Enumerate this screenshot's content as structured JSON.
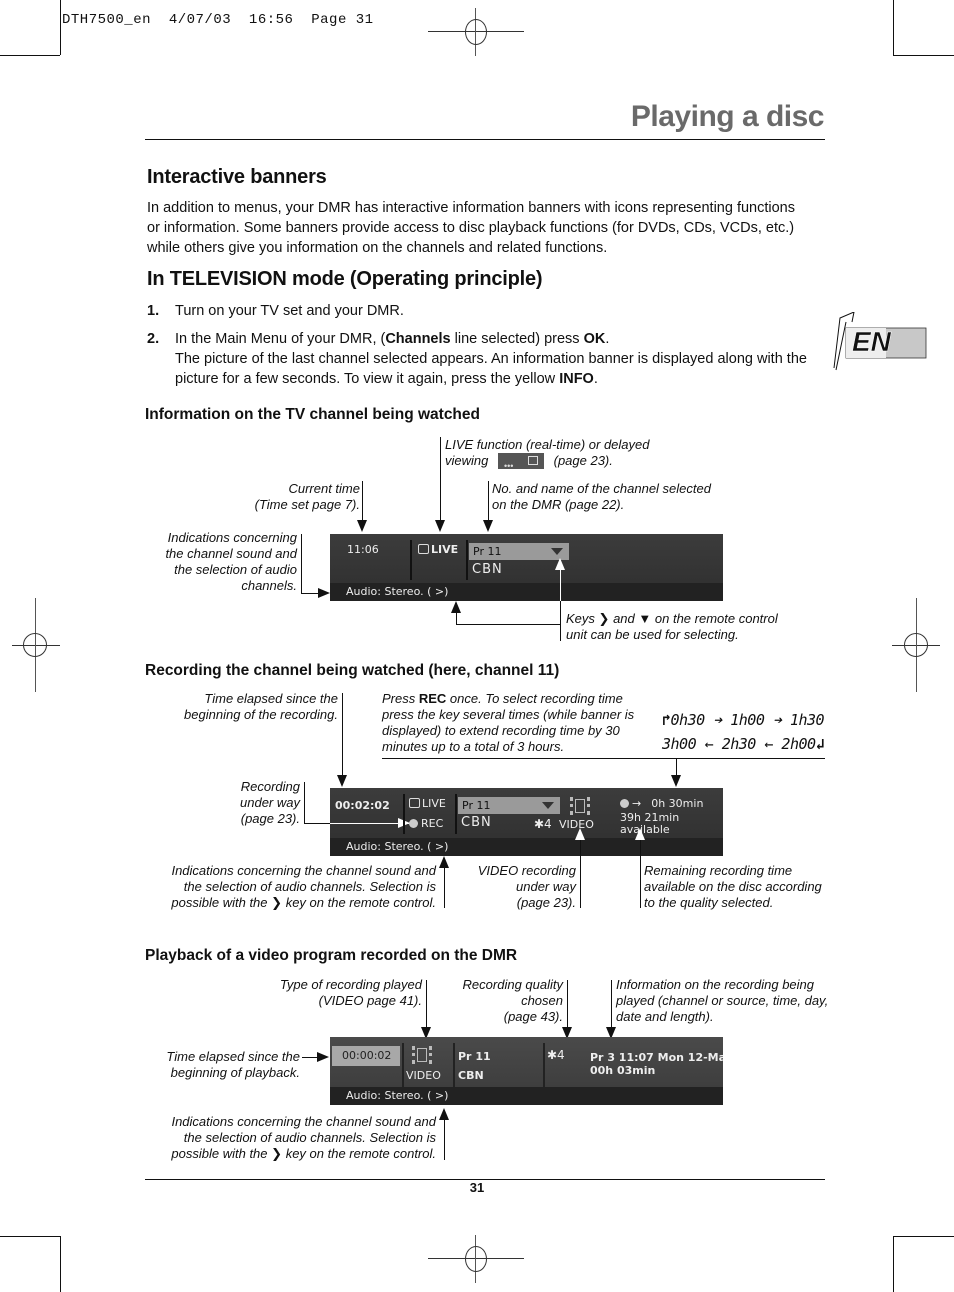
{
  "slug": "DTH7500_en  4/07/03  16:56  Page 31",
  "page_title": "Playing a disc",
  "lang_badge": "EN",
  "section1": {
    "title": "Interactive banners",
    "body": "In addition to menus, your DMR has interactive information banners with icons representing functions or information. Some banners provide access to disc playback functions (for DVDs, CDs, VCDs, etc.) while others give you information on the channels and related functions."
  },
  "section2": {
    "title": "In TELEVISION mode (Operating principle)",
    "steps": [
      {
        "num": "1.",
        "text": "Turn on your TV set and your DMR."
      },
      {
        "num": "2.",
        "pre": "In the Main Menu of your DMR, (",
        "b1": "Channels",
        "mid": " line selected) press ",
        "b2": "OK",
        "post": ".",
        "line2_pre": "The picture of the last channel selected appears. An information banner is displayed along with the picture for a few seconds. To view it again, press the yellow ",
        "b3": "INFO",
        "line2_post": "."
      }
    ]
  },
  "diagram1": {
    "title": "Information on the TV channel being watched",
    "cap_live_l1": "LIVE function (real-time) or delayed",
    "cap_live_l2_pre": "viewing",
    "cap_live_l2_post": "(page 23).",
    "cap_time_l1": "Current time",
    "cap_time_l2": "(Time set page 7).",
    "cap_chan_l1": "No. and name of the channel selected",
    "cap_chan_l2": "on the DMR (page 22).",
    "cap_audio": [
      "Indications concerning",
      "the channel sound and",
      "the selection of audio",
      "channels."
    ],
    "cap_keys_pre": "Keys",
    "cap_keys_and": "and",
    "cap_keys_post": "on the remote control",
    "cap_keys_l2": "unit can be used for selecting.",
    "banner": {
      "time": "11:06",
      "live": "LIVE",
      "channel_no": "Pr  11",
      "channel_name": "CBN",
      "audio": "Audio: Stereo.  ( >)"
    }
  },
  "diagram2": {
    "title": "Recording the channel being watched (here, channel 11)",
    "cap_elapsed": [
      "Time elapsed since the",
      "beginning of the recording."
    ],
    "cap_press_pre": "Press ",
    "cap_press_b": "REC",
    "cap_press_post": " once. To select recording time",
    "cap_press_rest": [
      "press the key several times (while banner is",
      "displayed) to extend recording time by 30",
      "minutes up to a total of 3 hours."
    ],
    "seq_row1": "0h30 ➔ 1h00 ➔ 1h30",
    "seq_row2": "3h00 ← 2h30 ← 2h00",
    "cap_rec": [
      "Recording",
      "under way",
      "(page 23)."
    ],
    "cap_audio": [
      "Indications concerning the channel sound and",
      "the selection of audio channels. Selection is",
      "possible with the",
      "key on the remote control."
    ],
    "cap_video": [
      "VIDEO recording",
      "under way",
      "(page 23)."
    ],
    "cap_remaining": [
      "Remaining recording time",
      "available on the disc according",
      "to the quality selected."
    ],
    "banner": {
      "time": "00:02:02",
      "live": "LIVE",
      "rec": "REC",
      "channel_no": "Pr  11",
      "channel_name": "CBN",
      "quality": "✱4",
      "video": "VIDEO",
      "rec_duration": "0h 30min",
      "available_l1": "39h 21min",
      "available_l2": "available",
      "audio": "Audio: Stereo.  ( >)"
    }
  },
  "diagram3": {
    "title": "Playback of a video program recorded on the DMR",
    "cap_type": [
      "Type of recording played",
      "(VIDEO page 41)."
    ],
    "cap_quality": [
      "Recording quality",
      "chosen",
      "(page 43)."
    ],
    "cap_info": [
      "Information on the recording being",
      "played (channel or source, time, day,",
      "date and length)."
    ],
    "cap_elapsed": [
      "Time elapsed since the",
      "beginning of playback."
    ],
    "cap_audio": [
      "Indications concerning the channel sound and",
      "the selection of audio channels. Selection is",
      "possible with the",
      "key on the remote control."
    ],
    "banner": {
      "time": "00:00:02",
      "video": "VIDEO",
      "channel_no": "Pr 11",
      "channel_name": "CBN",
      "quality": "✱4",
      "info_l1": "Pr 3 11:07 Mon 12-Ma",
      "info_l2": "00h 03min",
      "audio": "Audio: Stereo.  ( >)"
    }
  },
  "page_number": "31"
}
